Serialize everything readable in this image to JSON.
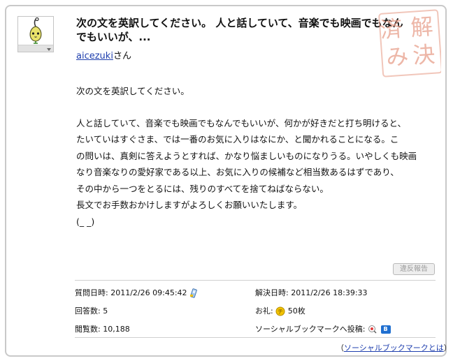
{
  "question": {
    "title": "次の文を英訳してください。 人と話していて、音楽でも映画でもなんでもいいが、...",
    "author_name": "aicezuki",
    "author_suffix": "さん",
    "stamp_text": "解決済み",
    "body_lines": [
      "次の文を英訳してください。",
      "",
      "人と話していて、音楽でも映画でもなんでもいいが、何かが好きだと打ち明けると、",
      "たいていはすぐさま、では一番のお気に入りはなにか、と聞かれることになる。こ",
      "の問いは、真剣に答えようとすれば、かなり悩ましいものになりうる。いやしくも映画",
      "なり音楽なりの愛好家である以上、お気に入りの候補など相当数あるはずであり、",
      "その中から一つをとるには、残りのすべてを捨てねばならない。",
      "長文でお手数おかけしますがよろしくお願いいたします。",
      "(_ _)"
    ],
    "report_button": "違反報告"
  },
  "meta": {
    "asked_label": "質問日時:",
    "asked_value": "2011/2/26 09:45:42",
    "solved_label": "解決日時:",
    "solved_value": "2011/2/26 18:39:33",
    "answers_label": "回答数:",
    "answers_value": "5",
    "reward_label": "お礼:",
    "reward_value": "50枚",
    "views_label": "閲覧数:",
    "views_value": "10,188",
    "social_label": "ソーシャルブックマークへ投稿:",
    "hatena_label": "B",
    "social_help_prefix": "（",
    "social_help_link": "ソーシャルブックマークとは",
    "social_help_suffix": "）"
  },
  "colors": {
    "link": "#1f3fae",
    "stamp": "#e8a08c",
    "coin": "#f2c200"
  }
}
